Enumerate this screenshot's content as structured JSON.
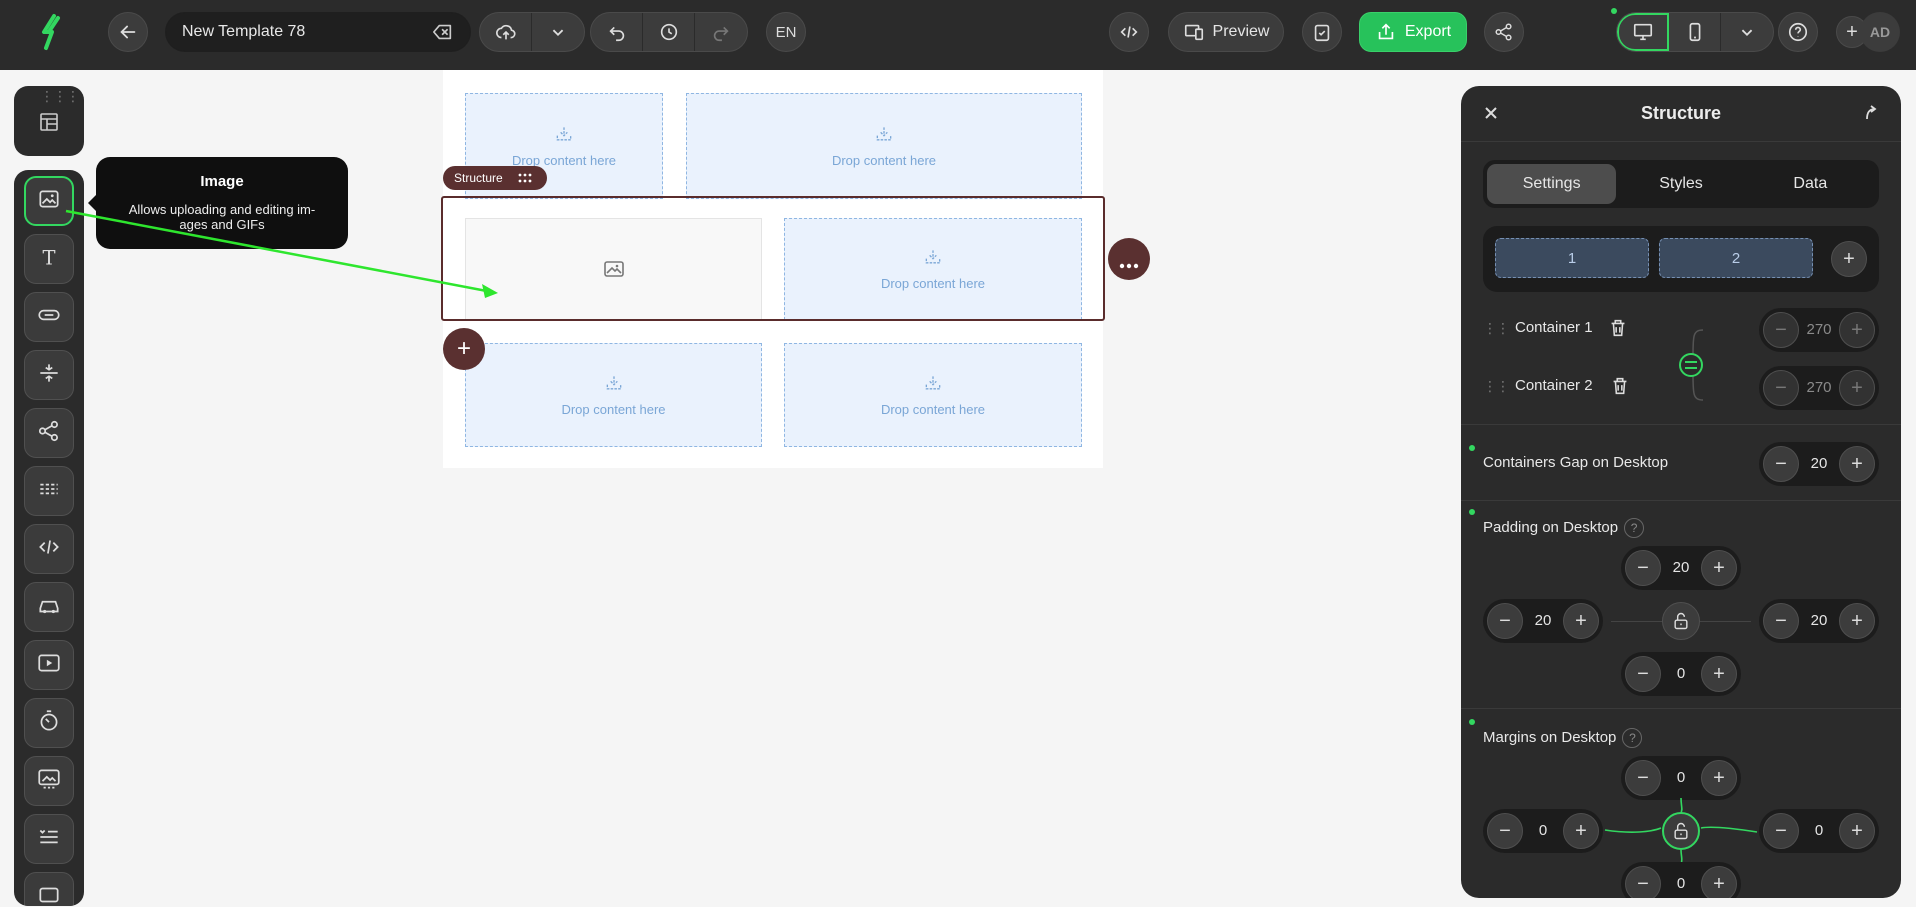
{
  "toolbar": {
    "template_name": "New Template 78",
    "language": "EN",
    "preview_label": "Preview",
    "export_label": "Export"
  },
  "tooltip": {
    "title": "Image",
    "description": "Allows uploading and editing im-ages and GIFs"
  },
  "canvas": {
    "structure_tag": "Structure",
    "drop_text": "Drop content here"
  },
  "panel": {
    "title": "Structure",
    "tabs": [
      {
        "label": "Settings",
        "active": true
      },
      {
        "label": "Styles",
        "active": false
      },
      {
        "label": "Data",
        "active": false
      }
    ],
    "columns": [
      "1",
      "2"
    ],
    "containers": [
      {
        "label": "Container 1",
        "width": "270"
      },
      {
        "label": "Container 2",
        "width": "270"
      }
    ],
    "gap": {
      "label": "Containers Gap on Desktop",
      "value": "20"
    },
    "padding": {
      "label": "Padding on Desktop",
      "top": "20",
      "left": "20",
      "right": "20",
      "bottom": "0"
    },
    "margins": {
      "label": "Margins on Desktop",
      "top": "0",
      "left": "0",
      "right": "0",
      "bottom": "0"
    }
  },
  "user": {
    "initials": "AD"
  },
  "colors": {
    "accent": "#27c25b",
    "structure": "#5a3030",
    "panel_bg": "#2b2b2b"
  }
}
